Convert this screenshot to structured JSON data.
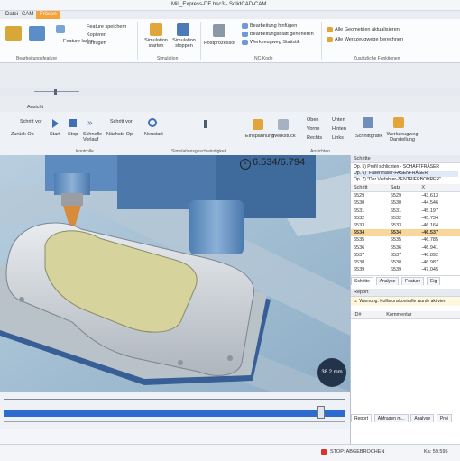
{
  "window": {
    "title": "Mill_Express-DE.bsc3 - SolidCAD-CAM"
  },
  "ribbon_tabs": [
    "Datei",
    "CAM",
    "Fräsen"
  ],
  "ribbon": {
    "feature_group_label": "Bearbeitungsfeature",
    "feature_items": [
      "Feature speichern",
      "Kopieren",
      "Einfügen"
    ],
    "feature_laden": "Feature laden",
    "simulation_buttons": [
      "Simulation starten",
      "Simulation stoppen"
    ],
    "simulation_group_label": "Simulation",
    "postprozessor": "Postprozessor",
    "nc_items": [
      "Bearbeitung hinfügen",
      "Bearbeitungsblatt generieren",
      "Werkzeugweg Statistik"
    ],
    "nc_group_label": "NC-Kode",
    "extra_items": [
      "Alle Geometrien aktualisieren",
      "Alle Werkzeugwege berechnen"
    ],
    "extra_group_label": "Zusätzliche Funktionen"
  },
  "view_tabs": [
    "Ansicht"
  ],
  "toolbar2": {
    "nav": [
      "Schritt vor",
      "Zurück Op",
      "Start",
      "Stop",
      "Schnelle Vorlauf",
      "Schritt vor",
      "Nächste Op",
      "Neustart"
    ],
    "nav_section": "Kontrolle",
    "speed_section": "Simulationsgeschwindigkeit",
    "display": [
      "Einspannung",
      "Werkstück"
    ],
    "views": [
      "Oben",
      "Vorne",
      "Rechts",
      "Unten",
      "Hinten",
      "Links"
    ],
    "views_section": "Ansichten",
    "tool_display": [
      "Schnittgrafik",
      "Werkzeugweg Darstellung"
    ]
  },
  "viewport": {
    "coords": "6.534/6.794",
    "badge": "38.2 mm"
  },
  "panel": {
    "ops_title": "Schritte",
    "ops": [
      "Op. 5) Profil schlichten - SCHAFTFRÄSER",
      "Op. 6) \"Fasenfräser-FASENFRÄSER\"",
      "Op. 7) \"Der Verfahrer-ZENTRIERBOHRER\""
    ],
    "table_headers": [
      "Schritt",
      "Satz",
      "X"
    ],
    "rows": [
      [
        "6529",
        "6529",
        "-43.613"
      ],
      [
        "6530",
        "6530",
        "-44.546"
      ],
      [
        "6531",
        "6531",
        "-45.197"
      ],
      [
        "6532",
        "6532",
        "-45.734"
      ],
      [
        "6533",
        "6533",
        "-46.164"
      ],
      [
        "6534",
        "6534",
        "-46.537"
      ],
      [
        "6535",
        "6535",
        "-46.785"
      ],
      [
        "6536",
        "6536",
        "-46.941"
      ],
      [
        "6537",
        "6537",
        "-46.892"
      ],
      [
        "6538",
        "6538",
        "-46.987"
      ],
      [
        "6539",
        "6539",
        "-47.045"
      ]
    ],
    "tabs": [
      "Schritte",
      "Analyse",
      "Feature",
      "Eig"
    ],
    "report_title": "Report",
    "warning": "Warnung: Kollisionskontrolle wurde aktiviert",
    "report_headers": [
      "ID#",
      "Kommentar"
    ],
    "bottom_tabs": [
      "Report",
      "Abfragen m...",
      "Analyse",
      "Proj"
    ]
  },
  "status": {
    "message": "STOP: ABGEBROCHEN",
    "coord": "Ka: 59.595"
  },
  "colors": {
    "accent": "#f7a13a",
    "selection": "#f9d79a",
    "viewport_bg": "#9fbfd3",
    "badge": "#23344a"
  }
}
